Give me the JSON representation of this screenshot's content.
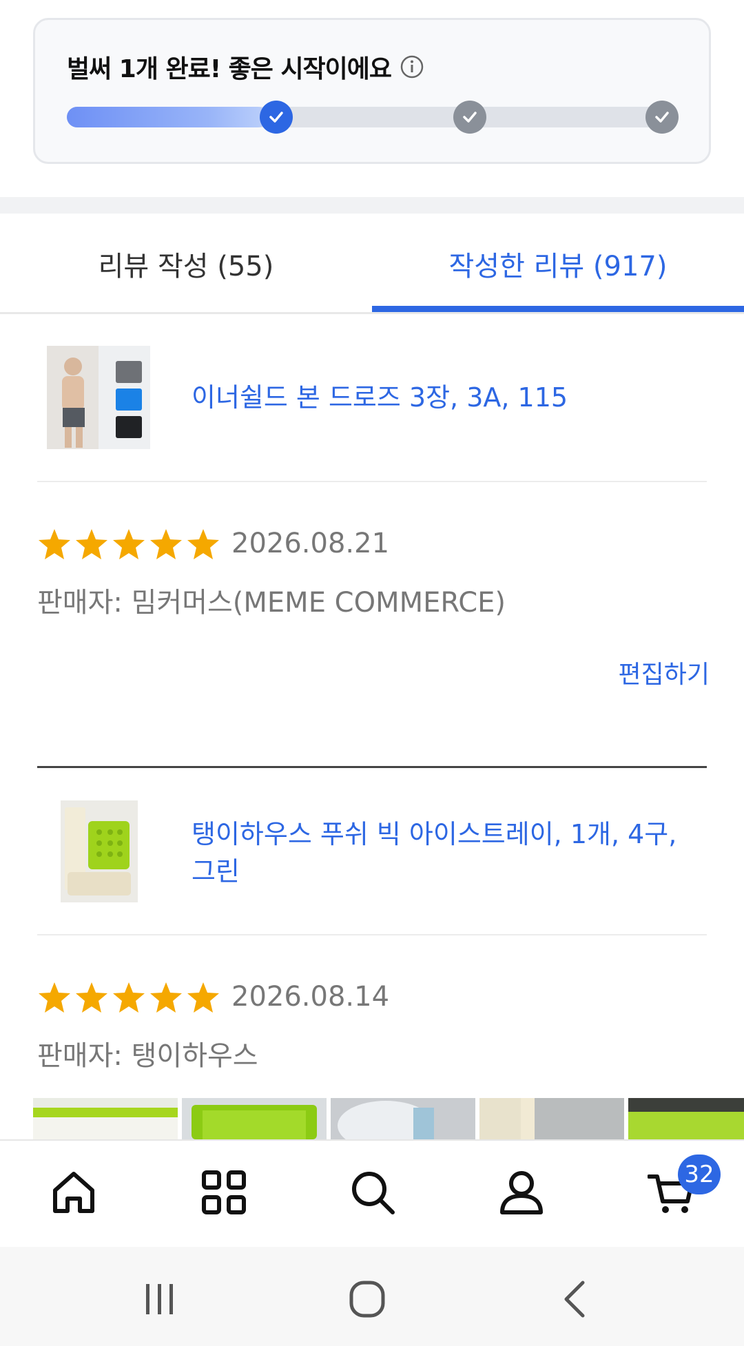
{
  "progress": {
    "title": "벌써 1개 완료! 좋은 시작이에요",
    "completed_steps": 1,
    "total_steps": 3,
    "fill_fraction": 0.33,
    "colors": {
      "done": "#2d67e3",
      "todo": "#8a9099"
    }
  },
  "tabs": [
    {
      "label": "리뷰 작성 (55)",
      "active": false
    },
    {
      "label": "작성한 리뷰 (917)",
      "active": true
    }
  ],
  "reviews": [
    {
      "product_name": "이너쉴드 본 드로즈 3장, 3A, 115",
      "rating": 5,
      "date": "2026.08.21",
      "seller": "판매자: 밈커머스(MEME COMMERCE)",
      "edit_label": "편집하기"
    },
    {
      "product_name_line1": "탱이하우스 푸쉬 빅 아이스트레이, 1개, 4구,",
      "product_name_line2": "그린",
      "rating": 5,
      "date": "2026.08.14",
      "seller": "판매자: 탱이하우스",
      "photo_count_visible": 5
    }
  ],
  "bottom_nav": {
    "items": [
      "home-icon",
      "categories-icon",
      "search-icon",
      "profile-icon",
      "cart-icon"
    ],
    "cart_count": "32"
  },
  "system_nav": [
    "recents-icon",
    "home-circle-icon",
    "back-icon"
  ],
  "colors": {
    "accent": "#2d67e3",
    "star": "#f5a800"
  }
}
